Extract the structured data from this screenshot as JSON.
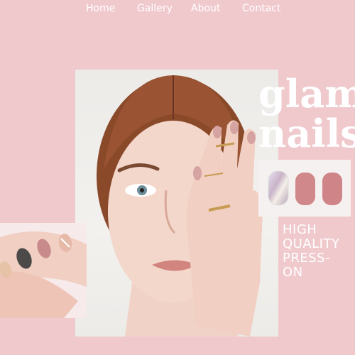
{
  "nav": {
    "items": [
      {
        "label": "Home"
      },
      {
        "label": "Gallery"
      },
      {
        "label": "About"
      },
      {
        "label": "Contact"
      }
    ]
  },
  "hero": {
    "title_line1": "glam",
    "title_line2": "nails",
    "tagline": [
      "HIGH",
      "QUALITY",
      "PRESS-",
      "ON"
    ]
  },
  "colors": {
    "background": "#f0c9cd",
    "text": "#ffffff",
    "nail_pink": "#d88c8e",
    "nail_mauve": "#c98a8c",
    "nail_gray": "#4b4a48"
  }
}
